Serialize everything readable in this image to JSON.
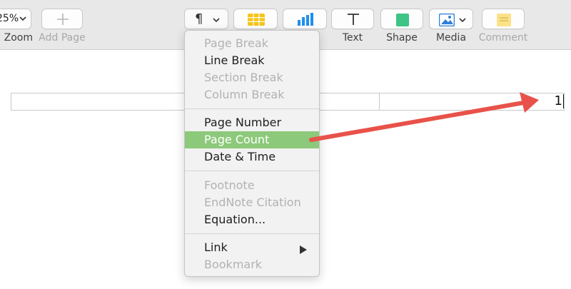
{
  "toolbar": {
    "zoom": {
      "value": "25%",
      "label": "Zoom"
    },
    "add_page": {
      "label": "Add Page"
    },
    "insert": {
      "icon": "pilcrow"
    },
    "table": {
      "icon": "table-icon"
    },
    "chart": {
      "icon": "chart-icon"
    },
    "text": {
      "label": "Text"
    },
    "shape": {
      "label": "Shape"
    },
    "media": {
      "label": "Media"
    },
    "comment": {
      "label": "Comment"
    }
  },
  "menu": {
    "items": [
      {
        "label": "Page Break",
        "enabled": false
      },
      {
        "label": "Line Break",
        "enabled": true
      },
      {
        "label": "Section Break",
        "enabled": false
      },
      {
        "label": "Column Break",
        "enabled": false
      },
      {
        "label": "Page Number",
        "enabled": true
      },
      {
        "label": "Page Count",
        "enabled": true,
        "selected": true
      },
      {
        "label": "Date & Time",
        "enabled": true
      },
      {
        "label": "Footnote",
        "enabled": false
      },
      {
        "label": "EndNote Citation",
        "enabled": false
      },
      {
        "label": "Equation...",
        "enabled": true
      },
      {
        "label": "Link",
        "enabled": true,
        "submenu": true
      },
      {
        "label": "Bookmark",
        "enabled": false
      }
    ]
  },
  "document": {
    "field_value": "1"
  },
  "colors": {
    "selection": "#8cc97a",
    "annotation_arrow": "#e8524a",
    "table_icon": "#f5c518",
    "chart_icon": "#1f8ff0",
    "shape_icon": "#3ec486",
    "media_icon": "#2f7fd6",
    "comment_icon": "#fbe28a"
  }
}
